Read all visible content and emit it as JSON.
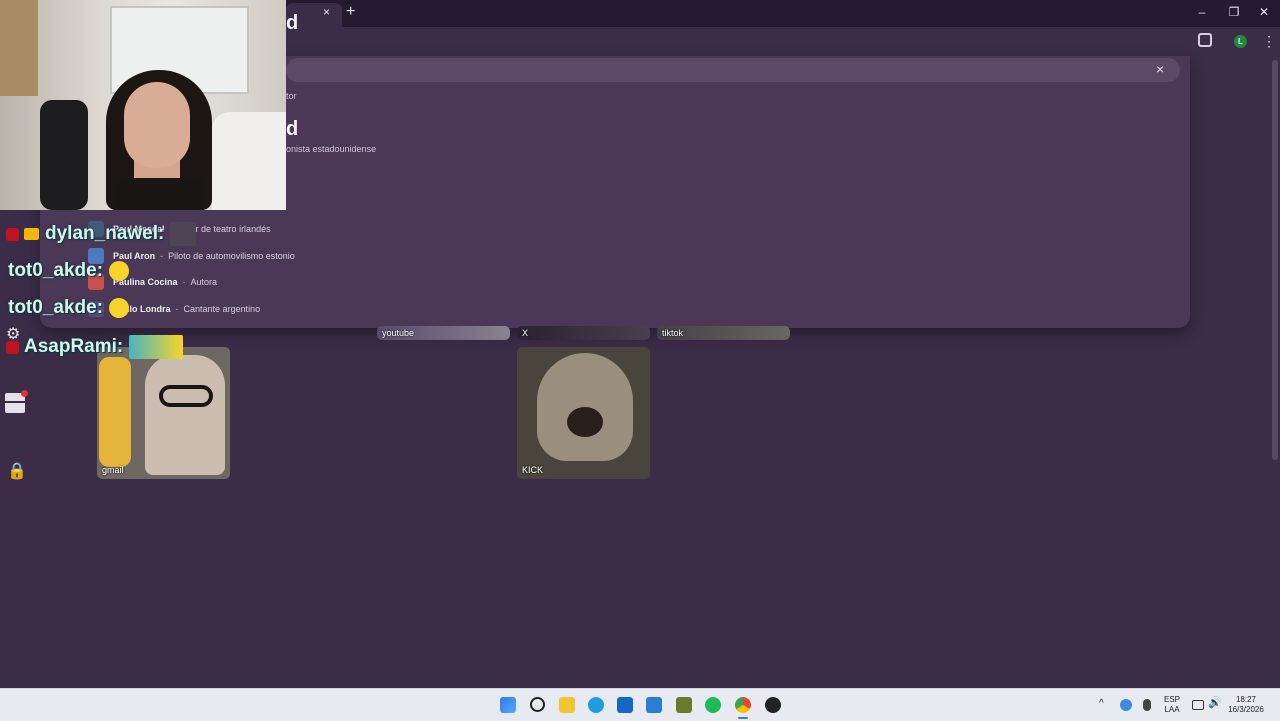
{
  "browser": {
    "tab_close": "×",
    "new_tab": "+",
    "window_minimize": "–",
    "window_restore": "❐",
    "window_close": "✕",
    "profile_initial": "L",
    "menu_glyph": "⋮",
    "header_partial": "d"
  },
  "search": {
    "clear_glyph": "×",
    "snippet_top": "tor",
    "result_title_partial": "d",
    "snippet_bottom": "onista estadounidense"
  },
  "suggestions": [
    {
      "name": "Paul Mescal",
      "sep": "-",
      "desc": "Actor de teatro irlandés",
      "thumb_color": "#3f5d7a"
    },
    {
      "name": "Paul Aron",
      "sep": "-",
      "desc": "Piloto de automovilismo estonio",
      "thumb_color": "#4c7bbf"
    },
    {
      "name": "Paulina Cocina",
      "sep": "-",
      "desc": "Autora",
      "thumb_color": "#c84f4f"
    },
    {
      "name": "Paulo Londra",
      "sep": "-",
      "desc": "Cantante argentino",
      "thumb_color": "#5b4b7a"
    }
  ],
  "tiles": {
    "youtube": "youtube",
    "x": "X",
    "tiktok": "tiktok",
    "gmail": "gmail",
    "kick": "KICK"
  },
  "chat": [
    {
      "user": "dylan_nawel",
      "sep": " :"
    },
    {
      "user": "tot0_akde",
      "sep": " :"
    },
    {
      "user": "tot0_akde",
      "sep": " :"
    },
    {
      "user": "AsapRami",
      "sep": " :"
    }
  ],
  "taskbar": {
    "lang_top": "ESP",
    "lang_bottom": "LAA",
    "time": "18:27",
    "date": "16/3/2026",
    "chevron": "^"
  },
  "colors": {
    "page_bg": "#3b2c48",
    "dropdown_bg": "#4b3856",
    "chat_text": "#d8f3f2",
    "taskbar_bg": "#e8eaf1"
  }
}
